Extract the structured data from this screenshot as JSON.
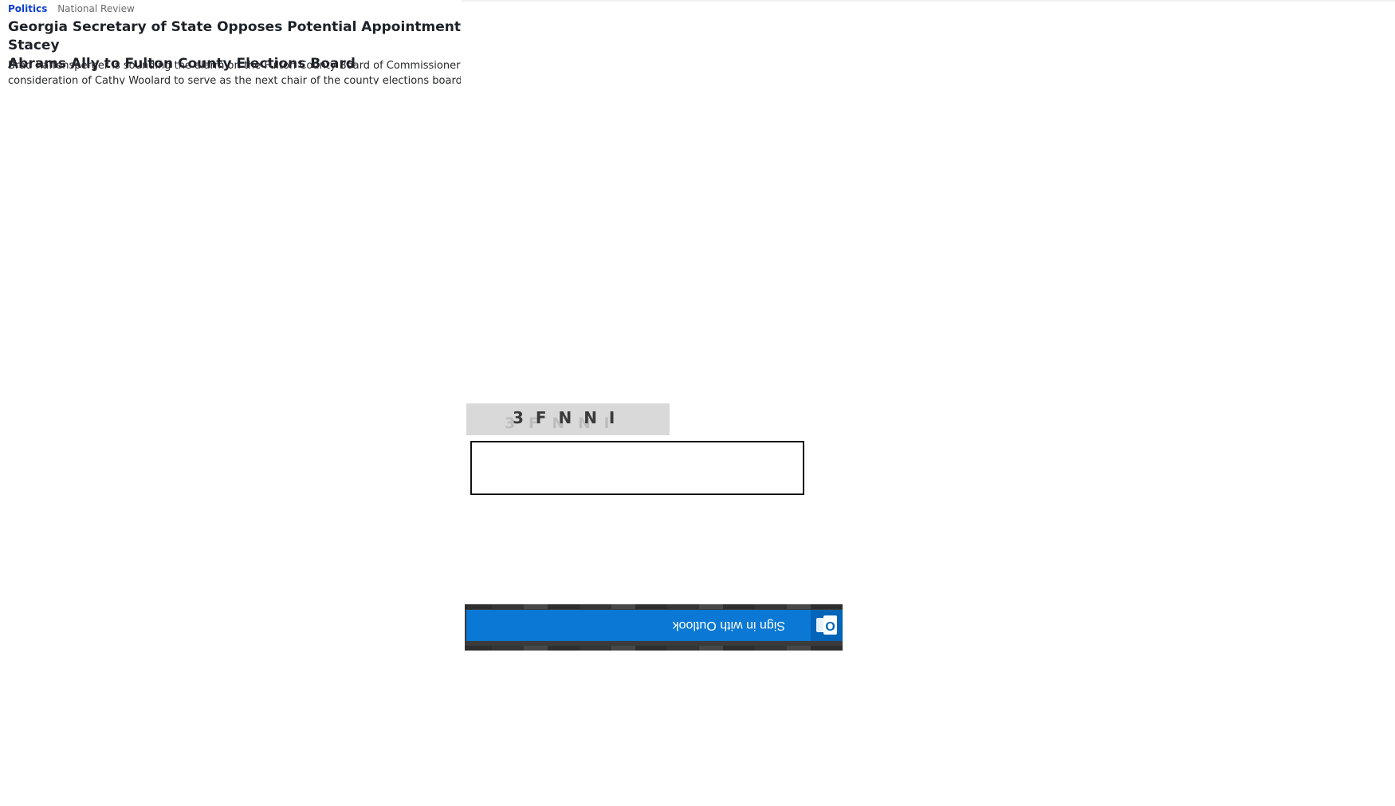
{
  "article": {
    "category": "Politics",
    "source": "National Review",
    "headline": "Georgia Secretary of State Opposes Potential Appointment of Stacey\nAbrams Ally to Fulton County Elections Board",
    "summary": "Brad Raffensperger is sounding the alarm on the Fulton County Board of Commissioners'\nconsideration of Cathy Woolard to serve as the next chair of the county elections board."
  },
  "captcha": {
    "text": "3 F N N I",
    "noise_text": "3 F N N I",
    "input_value": ""
  },
  "outlook": {
    "button_label": "Sign in with Outlook",
    "icon": "outlook-icon",
    "icon_letter": "O",
    "brand_color": "#0a78d4",
    "icon_bg_color": "#0364b8"
  }
}
